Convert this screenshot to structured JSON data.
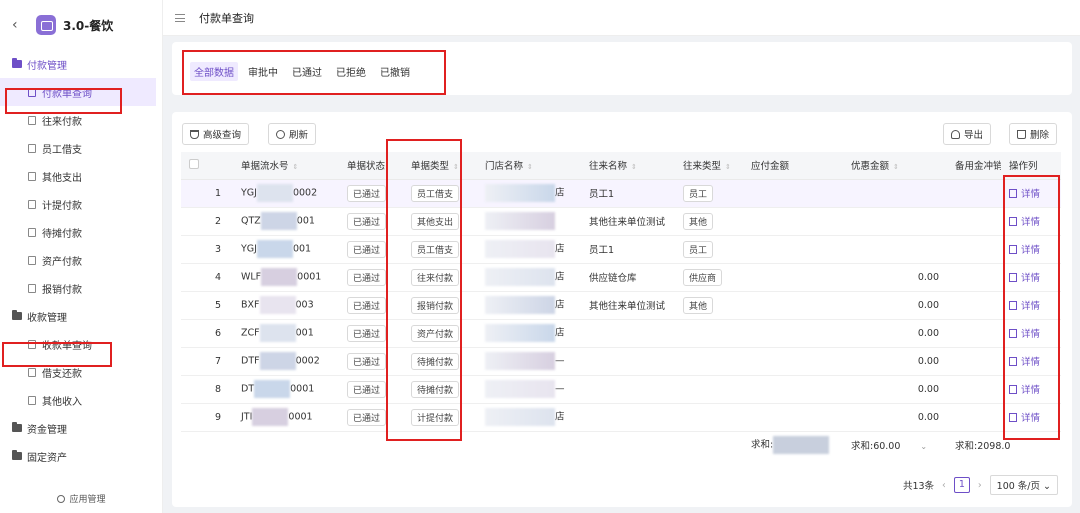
{
  "app": {
    "title": "3.0-餐饮",
    "footer": "应用管理"
  },
  "sidebar": {
    "groups": [
      {
        "label": "付款管理",
        "items": [
          "付款单查询",
          "往来付款",
          "员工借支",
          "其他支出",
          "计提付款",
          "待摊付款",
          "资产付款",
          "报销付款"
        ]
      },
      {
        "label": "收款管理",
        "items": [
          "收款单查询",
          "借支还款",
          "其他收入"
        ]
      },
      {
        "label": "资金管理"
      },
      {
        "label": "固定资产"
      }
    ]
  },
  "header": {
    "title": "付款单查询"
  },
  "tabs": [
    "全部数据",
    "审批中",
    "已通过",
    "已拒绝",
    "已撤销"
  ],
  "toolbar": {
    "advanced": "高级查询",
    "refresh": "刷新",
    "export": "导出",
    "delete": "删除"
  },
  "table": {
    "columns": [
      "单据流水号",
      "单据状态",
      "单据类型",
      "门店名称",
      "往来名称",
      "往来类型",
      "应付金额",
      "优惠金额",
      "备用金冲销",
      "操作列"
    ],
    "rows": [
      {
        "idx": "1",
        "serial_a": "YGJ",
        "serial_b": "0002",
        "status": "已通过",
        "type": "员工借支",
        "store": "店",
        "partner": "员工1",
        "ptype": "员工",
        "discount": "",
        "action": "详情"
      },
      {
        "idx": "2",
        "serial_a": "QTZ",
        "serial_b": "001",
        "status": "已通过",
        "type": "其他支出",
        "store": "",
        "partner": "其他往来单位测试",
        "ptype": "其他",
        "discount": "",
        "action": "详情"
      },
      {
        "idx": "3",
        "serial_a": "YGJ",
        "serial_b": "001",
        "status": "已通过",
        "type": "员工借支",
        "store": "店",
        "partner": "员工1",
        "ptype": "员工",
        "discount": "",
        "action": "详情"
      },
      {
        "idx": "4",
        "serial_a": "WLF",
        "serial_b": "0001",
        "status": "已通过",
        "type": "往来付款",
        "store": "店",
        "partner": "供应链仓库",
        "ptype": "供应商",
        "discount": "0.00",
        "action": "详情"
      },
      {
        "idx": "5",
        "serial_a": "BXF",
        "serial_b": "003",
        "status": "已通过",
        "type": "报销付款",
        "store": "店",
        "partner": "其他往来单位测试",
        "ptype": "其他",
        "discount": "0.00",
        "action": "详情"
      },
      {
        "idx": "6",
        "serial_a": "ZCF",
        "serial_b": "001",
        "status": "已通过",
        "type": "资产付款",
        "store": "店",
        "partner": "",
        "ptype": "",
        "discount": "0.00",
        "action": "详情"
      },
      {
        "idx": "7",
        "serial_a": "DTF",
        "serial_b": "0002",
        "status": "已通过",
        "type": "待摊付款",
        "store": "—",
        "partner": "",
        "ptype": "",
        "discount": "0.00",
        "action": "详情"
      },
      {
        "idx": "8",
        "serial_a": "DT",
        "serial_b": "0001",
        "status": "已通过",
        "type": "待摊付款",
        "store": "—",
        "partner": "",
        "ptype": "",
        "discount": "0.00",
        "action": "详情"
      },
      {
        "idx": "9",
        "serial_a": "JTI",
        "serial_b": "0001",
        "status": "已通过",
        "type": "计提付款",
        "store": "店",
        "partner": "",
        "ptype": "",
        "discount": "0.00",
        "action": "详情"
      }
    ],
    "summary": {
      "payable": "求和:",
      "discount": "求和:60.00",
      "reserve": "求和:2098.0"
    }
  },
  "pagination": {
    "total": "共13条",
    "page": "1",
    "size": "100 条/页"
  },
  "colors": {
    "accent": "#6e4fc7",
    "highlight": "#e02020"
  }
}
